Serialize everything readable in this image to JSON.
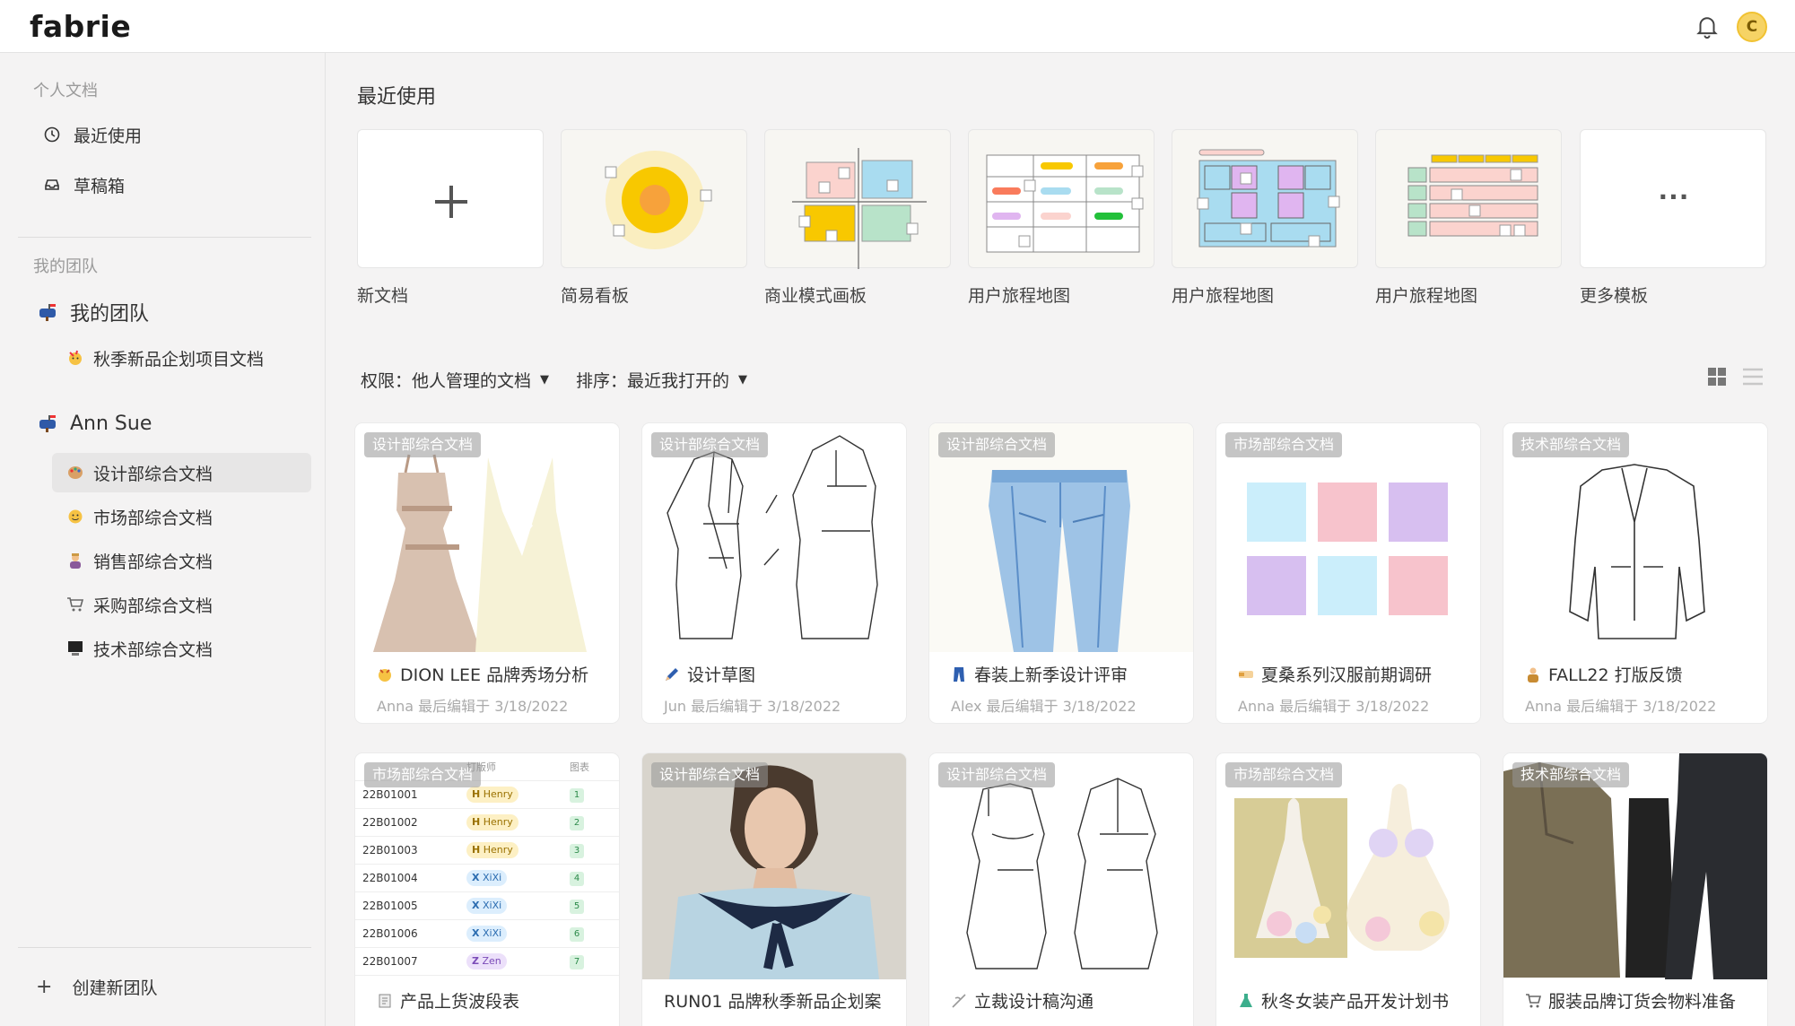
{
  "app": {
    "logo": "fabrie",
    "avatar_initial": "C"
  },
  "sidebar": {
    "personal_label": "个人文档",
    "personal_items": [
      {
        "label": "最近使用",
        "icon": "clock-icon"
      },
      {
        "label": "草稿箱",
        "icon": "inbox-icon"
      }
    ],
    "team_label": "我的团队",
    "teams": [
      {
        "name": "我的团队",
        "docs": [
          "秋季新品企划项目文档"
        ]
      },
      {
        "name": "Ann Sue",
        "docs": [
          "设计部综合文档",
          "市场部综合文档",
          "销售部综合文档",
          "采购部综合文档",
          "技术部综合文档"
        ]
      }
    ],
    "create_team": "创建新团队"
  },
  "main": {
    "recent_title": "最近使用",
    "templates": [
      {
        "label": "新文档"
      },
      {
        "label": "简易看板"
      },
      {
        "label": "商业模式画板"
      },
      {
        "label": "用户旅程地图"
      },
      {
        "label": "用户旅程地图"
      },
      {
        "label": "用户旅程地图"
      },
      {
        "label": "更多模板",
        "glyph": "···"
      }
    ],
    "filters": {
      "permission": "权限：他人管理的文档",
      "sort": "排序：最近我打开的"
    },
    "cards": [
      {
        "tag": "设计部综合文档",
        "title": "DION LEE 品牌秀场分析",
        "meta": "Anna 最后编辑于 3/18/2022"
      },
      {
        "tag": "设计部综合文档",
        "title": "设计草图",
        "meta": "Jun 最后编辑于 3/18/2022"
      },
      {
        "tag": "设计部综合文档",
        "title": "春装上新季设计评审",
        "meta": "Alex 最后编辑于 3/18/2022"
      },
      {
        "tag": "市场部综合文档",
        "title": "夏桑系列汉服前期调研",
        "meta": "Anna 最后编辑于 3/18/2022"
      },
      {
        "tag": "技术部综合文档",
        "title": "FALL22 打版反馈",
        "meta": "Anna 最后编辑于 3/18/2022"
      },
      {
        "tag": "市场部综合文档",
        "title": "产品上货波段表"
      },
      {
        "tag": "设计部综合文档",
        "title": "RUN01 品牌秋季新品企划案"
      },
      {
        "tag": "设计部综合文档",
        "title": "立裁设计稿沟通"
      },
      {
        "tag": "市场部综合文档",
        "title": "秋冬女装产品开发计划书"
      },
      {
        "tag": "技术部综合文档",
        "title": "服装品牌订货会物料准备"
      }
    ],
    "table_thumb": {
      "headers": [
        "打版师",
        "图表"
      ],
      "rows": [
        {
          "id": "22B01001",
          "initial": "H",
          "person": "Henry",
          "num": "1"
        },
        {
          "id": "22B01002",
          "initial": "H",
          "person": "Henry",
          "num": "2"
        },
        {
          "id": "22B01003",
          "initial": "H",
          "person": "Henry",
          "num": "3"
        },
        {
          "id": "22B01004",
          "initial": "X",
          "person": "XiXi",
          "num": "4"
        },
        {
          "id": "22B01005",
          "initial": "X",
          "person": "XiXi",
          "num": "5"
        },
        {
          "id": "22B01006",
          "initial": "X",
          "person": "XiXi",
          "num": "6"
        },
        {
          "id": "22B01007",
          "initial": "Z",
          "person": "Zen",
          "num": "7"
        }
      ]
    }
  }
}
